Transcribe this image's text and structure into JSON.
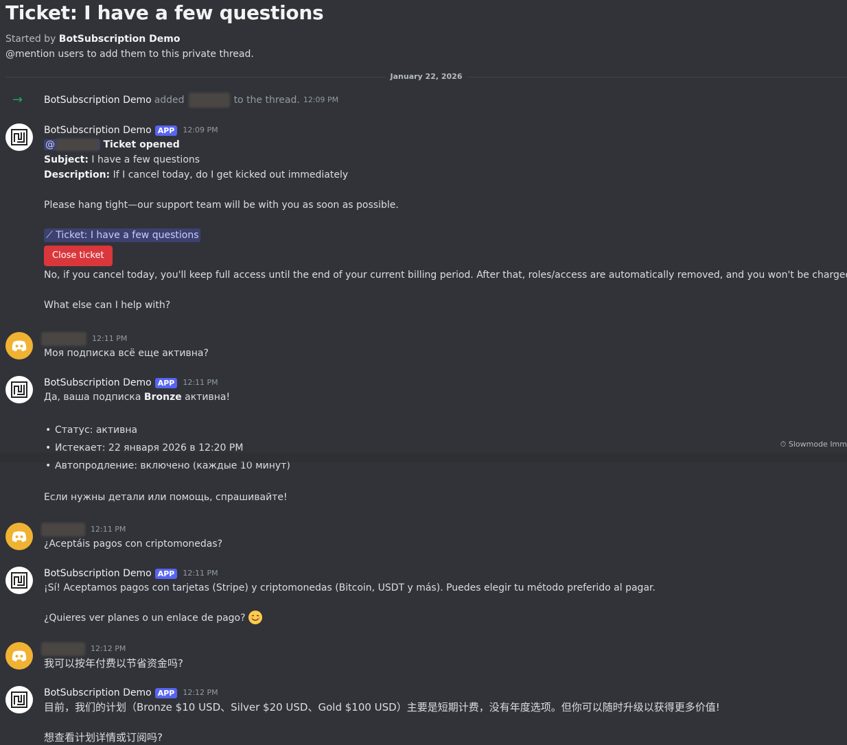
{
  "thread": {
    "title": "Ticket: I have a few questions",
    "started_prefix": "Started by",
    "started_by": "BotSubscription Demo",
    "hint": "@mention users to add them to this private thread.",
    "date": "January 22, 2026"
  },
  "system_message": {
    "actor": "BotSubscription Demo",
    "added": "added",
    "suffix": "to the thread.",
    "time": "12:09 PM"
  },
  "bot": {
    "name": "BotSubscription Demo",
    "tag": "APP"
  },
  "messages": [
    {
      "time": "12:09 PM",
      "mention": "@",
      "ticket_opened": "Ticket opened",
      "subject_label": "Subject:",
      "subject": "I have a few questions",
      "description_label": "Description:",
      "description": "If I cancel today, do I get kicked out immediately",
      "hang_tight": "Please hang tight—our support team will be with you as soon as possible.",
      "channel_link": "Ticket: I have a few questions",
      "close_button": "Close ticket",
      "reply": "No, if you cancel today, you'll keep full access until the end of your current billing period. After that, roles/access are automatically removed, and you won't be charged again.",
      "followup": "What else can I help with?"
    },
    {
      "time": "12:11 PM",
      "text": "Моя подписка всё еще активна?"
    },
    {
      "time": "12:11 PM",
      "text_pre": "Да, ваша подписка ",
      "text_bold": "Bronze",
      "text_post": " активна!",
      "bullets": [
        "Статус: активна",
        "Истекает: 22 января 2026 в 12:20 PM",
        "Автопродление: включено (каждые 10 минут)"
      ],
      "closing": "Если нужны детали или помощь, спрашивайте!"
    },
    {
      "time": "12:11 PM",
      "text": "¿Aceptáis pagos con criptomonedas?"
    },
    {
      "time": "12:11 PM",
      "text": "¡Sí! Aceptamos pagos con tarjetas (Stripe) y criptomonedas (Bitcoin, USDT y más). Puedes elegir tu método preferido al pagar.",
      "followup": "¿Quieres ver planes o un enlace de pago?"
    },
    {
      "time": "12:12 PM",
      "text": "我可以按年付费以节省资金吗?"
    },
    {
      "time": "12:12 PM",
      "text": "目前，我们的计划（Bronze $10 USD、Silver $20 USD、Gold $100 USD）主要是短期计费，没有年度选项。但你可以随时升级以获得更多价值!",
      "followup": "想查看计划详情或订阅吗?"
    }
  ],
  "slowmode": "Slowmode Imm",
  "colors": {
    "app_tag": "#5865f2",
    "close_button": "#da373c",
    "user_avatar": "#f0b232"
  }
}
